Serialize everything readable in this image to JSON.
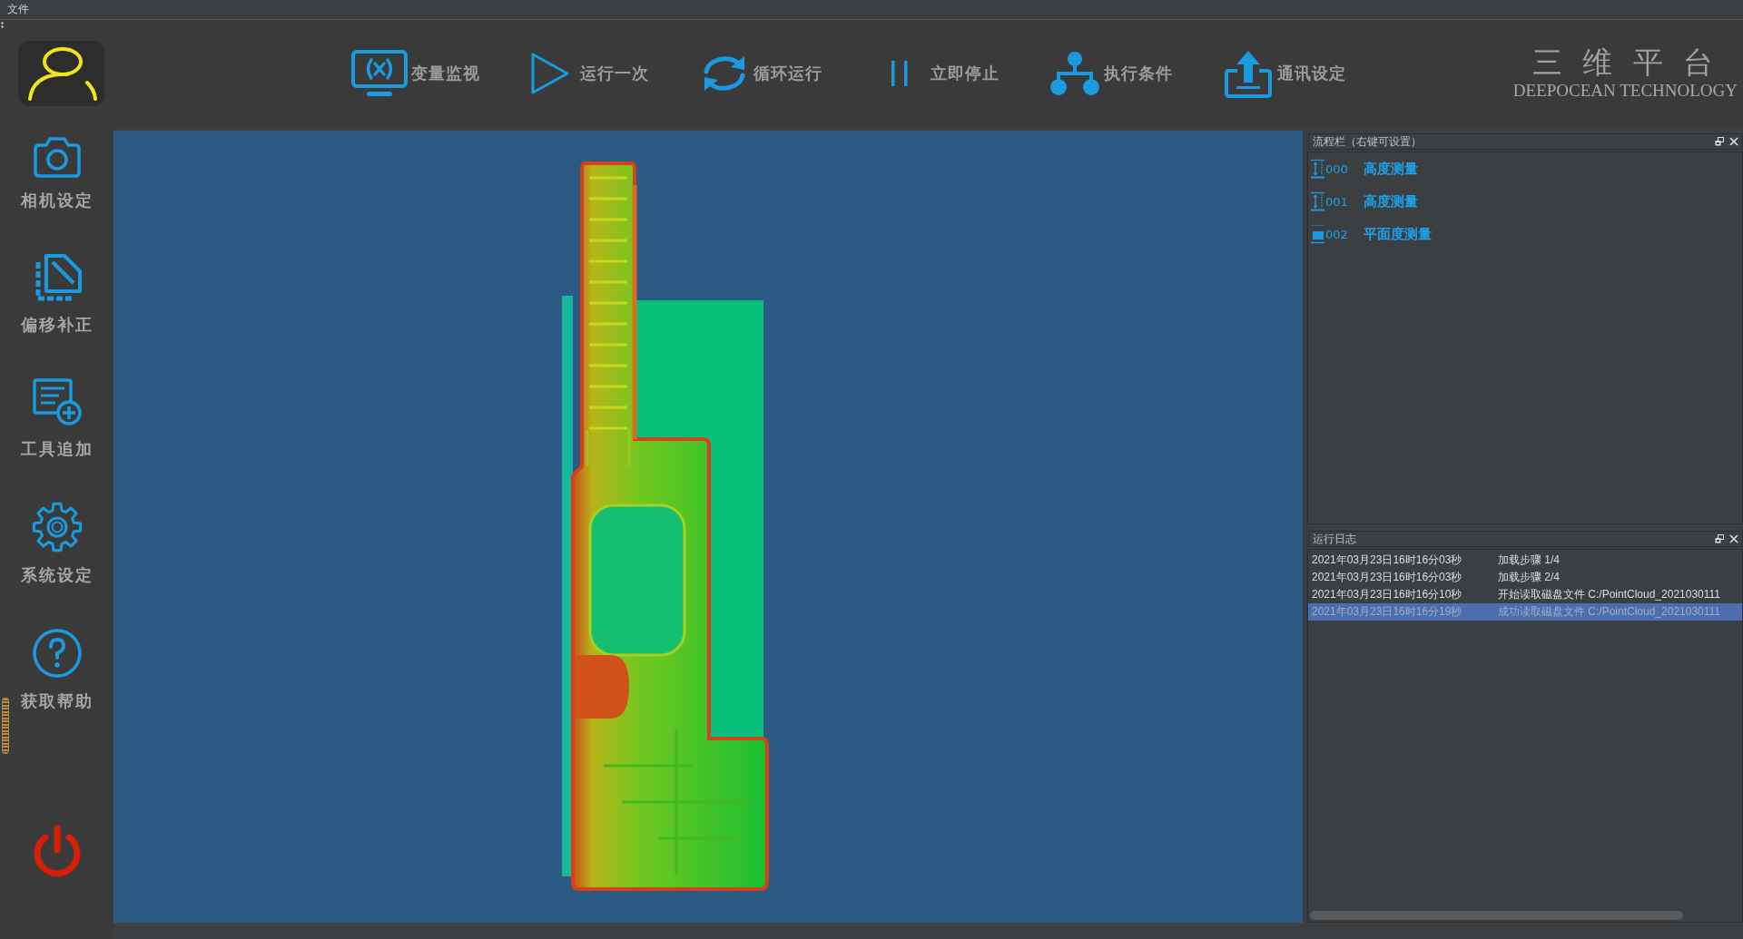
{
  "menu_bar": {
    "items": [
      {
        "label": "文件"
      }
    ]
  },
  "toolbar": {
    "buttons": [
      {
        "label": "变量监视"
      },
      {
        "label": "运行一次"
      },
      {
        "label": "循环运行"
      },
      {
        "label": "立即停止"
      },
      {
        "label": "执行条件"
      },
      {
        "label": "通讯设定"
      }
    ]
  },
  "logo": {
    "title": "三 维 平 台",
    "subtitle": "DEEPOCEAN TECHNOLOGY"
  },
  "sidebar": {
    "items": [
      {
        "label": "相机设定"
      },
      {
        "label": "偏移补正"
      },
      {
        "label": "工具追加"
      },
      {
        "label": "系统设定"
      },
      {
        "label": "获取帮助"
      }
    ]
  },
  "flow_panel": {
    "title": "流程栏（右键可设置）",
    "steps": [
      {
        "kind": "height",
        "number": "000",
        "name": "高度测量"
      },
      {
        "kind": "height",
        "number": "001",
        "name": "高度测量"
      },
      {
        "kind": "flatness",
        "number": "002",
        "name": "平面度测量"
      }
    ]
  },
  "log_panel": {
    "title": "运行日志",
    "rows": [
      {
        "time": "2021年03月23日16时16分03秒",
        "message": "加载步骤 1/4",
        "selected": false
      },
      {
        "time": "2021年03月23日16时16分03秒",
        "message": "加载步骤 2/4",
        "selected": false
      },
      {
        "time": "2021年03月23日16时16分10秒",
        "message": "开始读取磁盘文件 C:/PointCloud_2021030111",
        "selected": false
      },
      {
        "time": "2021年03月23日16时16分19秒",
        "message": "成功读取磁盘文件 C:/PointCloud_2021030111",
        "selected": true
      }
    ]
  }
}
